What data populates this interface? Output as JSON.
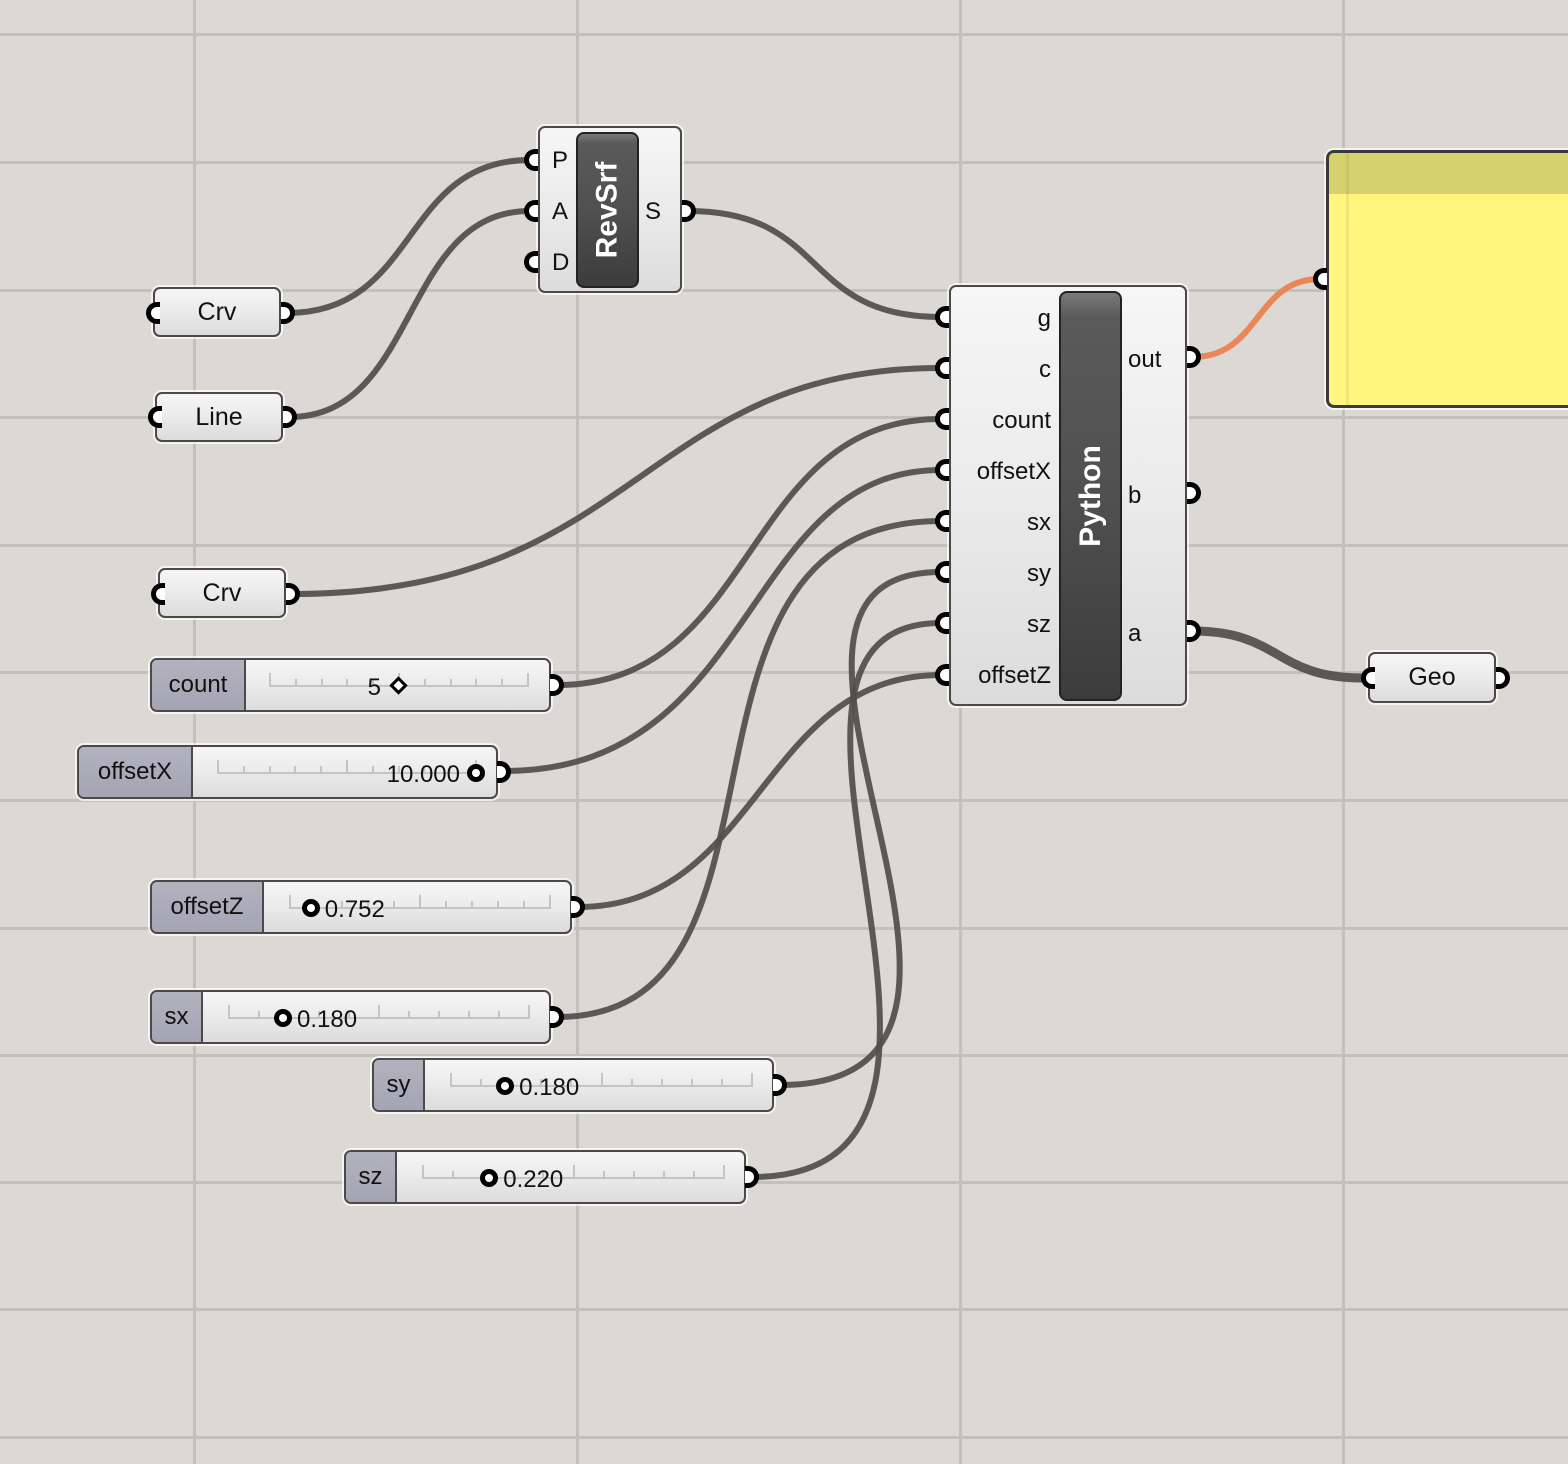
{
  "canvas": {
    "background": "#dcd9d4",
    "grid_color": "#c2c0bb",
    "wire_color": "#4f4e4b",
    "selected_wire_color": "#ea8658"
  },
  "components": {
    "crv_1": {
      "label": "Crv",
      "type": "curve-parameter"
    },
    "line": {
      "label": "Line",
      "type": "line-parameter"
    },
    "crv_2": {
      "label": "Crv",
      "type": "curve-parameter"
    },
    "geo": {
      "label": "Geo",
      "type": "geometry-parameter"
    },
    "revsrf": {
      "name": "RevSrf",
      "inputs": [
        "P",
        "A",
        "D"
      ],
      "outputs": [
        "S"
      ]
    },
    "python": {
      "name": "Python",
      "inputs": [
        "g",
        "c",
        "count",
        "offsetX",
        "sx",
        "sy",
        "sz",
        "offsetZ"
      ],
      "outputs": [
        "out",
        "b",
        "a"
      ]
    },
    "panel": {
      "type": "panel",
      "content": "",
      "color": "#fff57f",
      "header_color": "#d6d16f"
    }
  },
  "sliders": {
    "count": {
      "label": "count",
      "value": "5",
      "knob": "diamond",
      "fraction": 0.5
    },
    "offsetX": {
      "label": "offsetX",
      "value": "10.000",
      "knob": "circle",
      "fraction": 1.0
    },
    "offsetZ": {
      "label": "offsetZ",
      "value": "0.752",
      "knob": "circle",
      "fraction": 0.08
    },
    "sx": {
      "label": "sx",
      "value": "0.180",
      "knob": "circle",
      "fraction": 0.18
    },
    "sy": {
      "label": "sy",
      "value": "0.180",
      "knob": "circle",
      "fraction": 0.18
    },
    "sz": {
      "label": "sz",
      "value": "0.220",
      "knob": "circle",
      "fraction": 0.22
    }
  },
  "connections": [
    {
      "from": "crv_1.out",
      "to": "revsrf.P"
    },
    {
      "from": "line.out",
      "to": "revsrf.A"
    },
    {
      "from": "revsrf.S",
      "to": "python.g"
    },
    {
      "from": "crv_2.out",
      "to": "python.c"
    },
    {
      "from": "count",
      "to": "python.count"
    },
    {
      "from": "offsetX",
      "to": "python.offsetX"
    },
    {
      "from": "sx",
      "to": "python.sx"
    },
    {
      "from": "sy",
      "to": "python.sy"
    },
    {
      "from": "sz",
      "to": "python.sz"
    },
    {
      "from": "offsetZ",
      "to": "python.offsetZ"
    },
    {
      "from": "python.out",
      "to": "panel.in",
      "selected": true
    },
    {
      "from": "python.a",
      "to": "geo.in",
      "multi": true
    }
  ]
}
